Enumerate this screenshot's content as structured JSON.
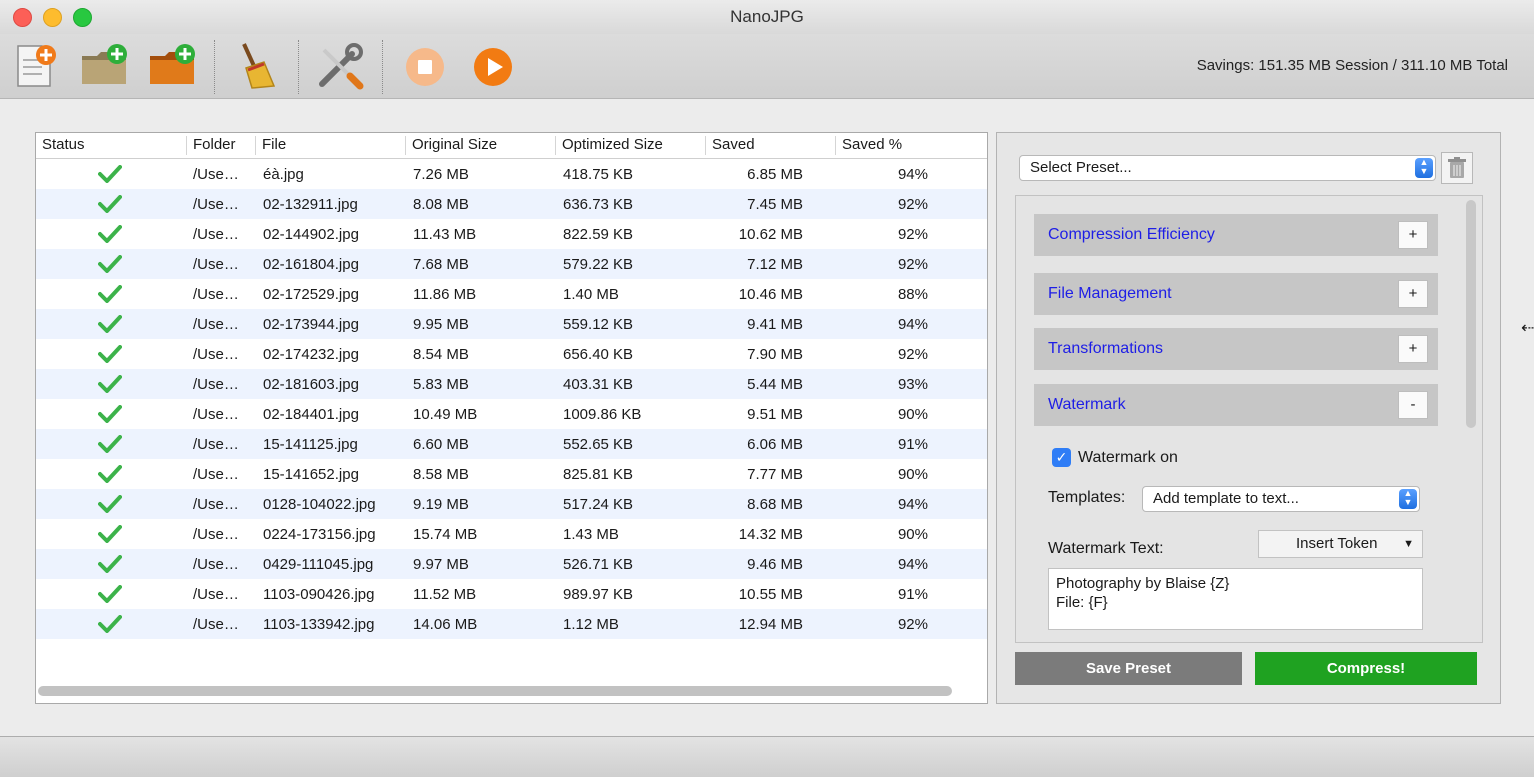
{
  "window": {
    "title": "NanoJPG"
  },
  "toolbar": {
    "buttons": [
      {
        "name": "add-files",
        "icon": "add-file-icon"
      },
      {
        "name": "add-folder",
        "icon": "add-folder-icon"
      },
      {
        "name": "add-folder-recursive",
        "icon": "add-folder-orange-icon"
      },
      {
        "name": "clear",
        "icon": "broom-icon"
      },
      {
        "name": "settings",
        "icon": "tools-icon"
      },
      {
        "name": "stop",
        "icon": "stop-icon"
      },
      {
        "name": "start",
        "icon": "play-icon"
      }
    ],
    "savings": "Savings: 151.35 MB Session / 311.10 MB Total"
  },
  "table": {
    "columns": [
      "Status",
      "Folder",
      "File",
      "Original Size",
      "Optimized Size",
      "Saved",
      "Saved %"
    ],
    "rows": [
      {
        "status": "done",
        "folder": "/Use…",
        "file": "éà.jpg",
        "original": "7.26 MB",
        "optimized": "418.75 KB",
        "saved": "6.85 MB",
        "pct": "94%"
      },
      {
        "status": "done",
        "folder": "/Use…",
        "file": "02-132911.jpg",
        "original": "8.08 MB",
        "optimized": "636.73 KB",
        "saved": "7.45 MB",
        "pct": "92%"
      },
      {
        "status": "done",
        "folder": "/Use…",
        "file": "02-144902.jpg",
        "original": "11.43 MB",
        "optimized": "822.59 KB",
        "saved": "10.62 MB",
        "pct": "92%"
      },
      {
        "status": "done",
        "folder": "/Use…",
        "file": "02-161804.jpg",
        "original": "7.68 MB",
        "optimized": "579.22 KB",
        "saved": "7.12 MB",
        "pct": "92%"
      },
      {
        "status": "done",
        "folder": "/Use…",
        "file": "02-172529.jpg",
        "original": "11.86 MB",
        "optimized": "1.40 MB",
        "saved": "10.46 MB",
        "pct": "88%"
      },
      {
        "status": "done",
        "folder": "/Use…",
        "file": "02-173944.jpg",
        "original": "9.95 MB",
        "optimized": "559.12 KB",
        "saved": "9.41 MB",
        "pct": "94%"
      },
      {
        "status": "done",
        "folder": "/Use…",
        "file": "02-174232.jpg",
        "original": "8.54 MB",
        "optimized": "656.40 KB",
        "saved": "7.90 MB",
        "pct": "92%"
      },
      {
        "status": "done",
        "folder": "/Use…",
        "file": "02-181603.jpg",
        "original": "5.83 MB",
        "optimized": "403.31 KB",
        "saved": "5.44 MB",
        "pct": "93%"
      },
      {
        "status": "done",
        "folder": "/Use…",
        "file": "02-184401.jpg",
        "original": "10.49 MB",
        "optimized": "1009.86 KB",
        "saved": "9.51 MB",
        "pct": "90%"
      },
      {
        "status": "done",
        "folder": "/Use…",
        "file": "15-141125.jpg",
        "original": "6.60 MB",
        "optimized": "552.65 KB",
        "saved": "6.06 MB",
        "pct": "91%"
      },
      {
        "status": "done",
        "folder": "/Use…",
        "file": "15-141652.jpg",
        "original": "8.58 MB",
        "optimized": "825.81 KB",
        "saved": "7.77 MB",
        "pct": "90%"
      },
      {
        "status": "done",
        "folder": "/Use…",
        "file": "0128-104022.jpg",
        "original": "9.19 MB",
        "optimized": "517.24 KB",
        "saved": "8.68 MB",
        "pct": "94%"
      },
      {
        "status": "done",
        "folder": "/Use…",
        "file": "0224-173156.jpg",
        "original": "15.74 MB",
        "optimized": "1.43 MB",
        "saved": "14.32 MB",
        "pct": "90%"
      },
      {
        "status": "done",
        "folder": "/Use…",
        "file": "0429-111045.jpg",
        "original": "9.97 MB",
        "optimized": "526.71 KB",
        "saved": "9.46 MB",
        "pct": "94%"
      },
      {
        "status": "done",
        "folder": "/Use…",
        "file": "1103-090426.jpg",
        "original": "11.52 MB",
        "optimized": "989.97 KB",
        "saved": "10.55 MB",
        "pct": "91%"
      },
      {
        "status": "done",
        "folder": "/Use…",
        "file": "1103-133942.jpg",
        "original": "14.06 MB",
        "optimized": "1.12 MB",
        "saved": "12.94 MB",
        "pct": "92%"
      }
    ]
  },
  "settings": {
    "preset_placeholder": "Select Preset...",
    "sections": [
      {
        "title": "Compression Efficiency",
        "toggle": "+"
      },
      {
        "title": "File Management",
        "toggle": "+"
      },
      {
        "title": "Transformations",
        "toggle": "+"
      },
      {
        "title": "Watermark",
        "toggle": "-"
      }
    ],
    "watermark": {
      "enabled_label": "Watermark on",
      "templates_label": "Templates:",
      "templates_value": "Add template to text...",
      "text_label": "Watermark Text:",
      "insert_token": "Insert Token",
      "text_lines": [
        "Photography by Blaise {Z}",
        "File: {F}"
      ]
    },
    "save_preset": "Save Preset",
    "compress": "Compress!"
  },
  "colors": {
    "check_green": "#3cb34a",
    "section_link": "#1e1ee6",
    "compress_green": "#1fa221",
    "save_gray": "#7b7b7b",
    "alt_row": "#edf3fe"
  }
}
